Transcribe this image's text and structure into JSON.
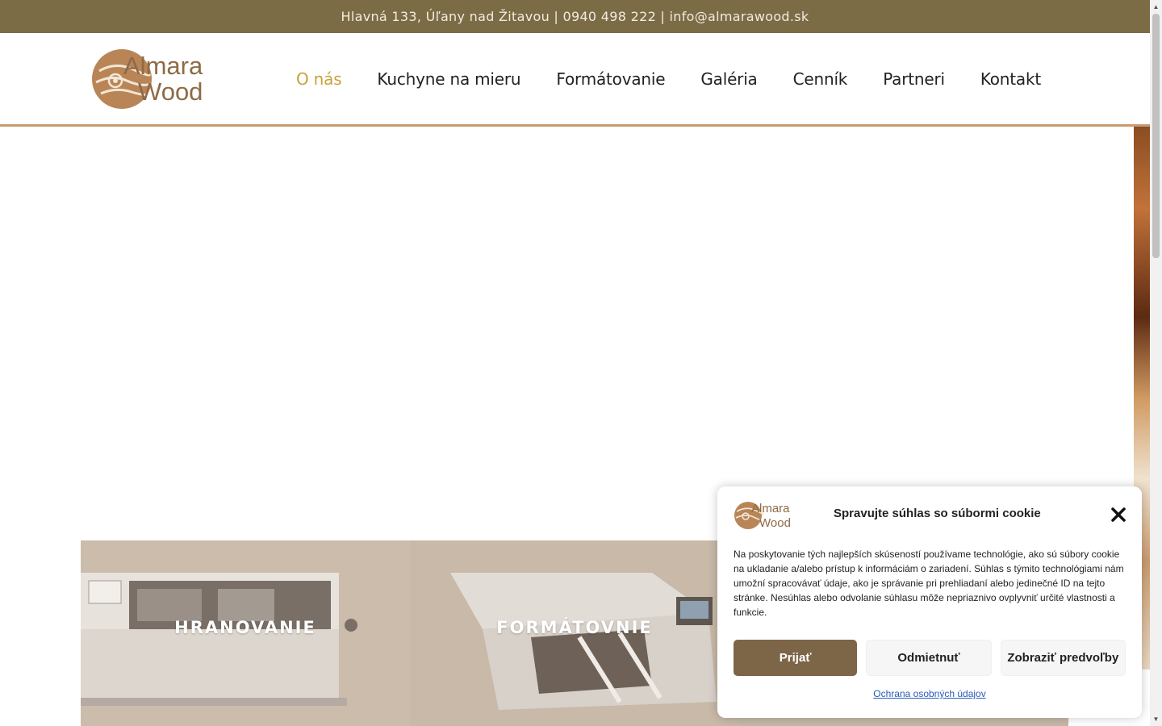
{
  "topbar": {
    "text": "Hlavná 133, Úľany nad Žitavou | 0940 498 222 | info@almarawood.sk"
  },
  "header": {
    "logo": {
      "line1": "Almara",
      "line2": "Wood"
    },
    "nav": [
      {
        "label": "O nás",
        "active": true
      },
      {
        "label": "Kuchyne na mieru",
        "active": false
      },
      {
        "label": "Formátovanie",
        "active": false
      },
      {
        "label": "Galéria",
        "active": false
      },
      {
        "label": "Cenník",
        "active": false
      },
      {
        "label": "Partneri",
        "active": false
      },
      {
        "label": "Kontakt",
        "active": false
      }
    ]
  },
  "services": [
    {
      "label": "HRANOVANIE"
    },
    {
      "label": "FORMÁTOVNIE"
    }
  ],
  "cookie": {
    "title": "Spravujte súhlas so súbormi cookie",
    "text": "Na poskytovanie tých najlepších skúseností používame technológie, ako sú súbory cookie na ukladanie a/alebo prístup k informáciám o zariadení. Súhlas s týmito technológiami nám umožní spracovávať údaje, ako je správanie pri prehliadaní alebo jedinečné ID na tejto stránke. Nesúhlas alebo odvolanie súhlasu môže nepriaznivo ovplyvniť určité vlastnosti a funkcie.",
    "accept_label": "Prijať",
    "deny_label": "Odmietnuť",
    "prefs_label": "Zobraziť predvoľby",
    "privacy_link": "Ochrana osobných údajov"
  },
  "colors": {
    "topbar": "#7b6c46",
    "accent": "#c8a23a",
    "logo_brown": "#a5724a",
    "accept_button": "#7d6548"
  }
}
